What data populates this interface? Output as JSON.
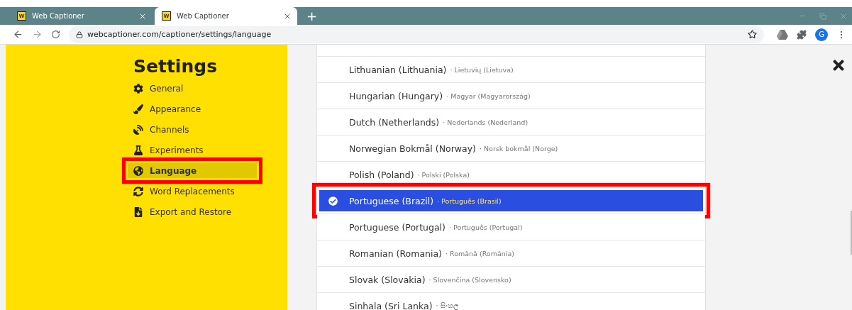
{
  "browser": {
    "tabs": [
      {
        "title": "Web Captioner",
        "favicon": "W",
        "selected": false
      },
      {
        "title": "Web Captioner",
        "favicon": "W",
        "selected": true
      }
    ],
    "new_tab": "+",
    "address": "webcaptioner.com/captioner/settings/language",
    "avatar": "G"
  },
  "sidebar": {
    "title": "Settings",
    "items": [
      {
        "label": "General",
        "kind": "gear",
        "selected": false
      },
      {
        "label": "Appearance",
        "kind": "brush",
        "selected": false
      },
      {
        "label": "Channels",
        "kind": "dish",
        "selected": false
      },
      {
        "label": "Experiments",
        "kind": "flask",
        "selected": false
      },
      {
        "label": "Language",
        "kind": "globe",
        "selected": true
      },
      {
        "label": "Word Replacements",
        "kind": "sync",
        "selected": false
      },
      {
        "label": "Export and Restore",
        "kind": "file",
        "selected": false
      }
    ]
  },
  "languages": [
    {
      "name": "Lithuanian (Lithuania)",
      "native": "· Lietuvių (Lietuva)",
      "selected": false
    },
    {
      "name": "Hungarian (Hungary)",
      "native": "· Magyar (Magyarország)",
      "selected": false
    },
    {
      "name": "Dutch (Netherlands)",
      "native": "· Nederlands (Nederland)",
      "selected": false
    },
    {
      "name": "Norwegian Bokmål (Norway)",
      "native": "· Norsk bokmål (Norge)",
      "selected": false
    },
    {
      "name": "Polish (Poland)",
      "native": "· Polski (Polska)",
      "selected": false
    },
    {
      "name": "Portuguese (Brazil)",
      "native": "· Português (Brasil)",
      "selected": true
    },
    {
      "name": "Portuguese (Portugal)",
      "native": "· Português (Portugal)",
      "selected": false
    },
    {
      "name": "Romanian (Romania)",
      "native": "· Română (România)",
      "selected": false
    },
    {
      "name": "Slovak (Slovakia)",
      "native": "· Slovenčina (Slovensko)",
      "selected": false
    },
    {
      "name": "Sinhala (Sri Lanka)",
      "native": "· සිංහල",
      "selected": false
    }
  ]
}
